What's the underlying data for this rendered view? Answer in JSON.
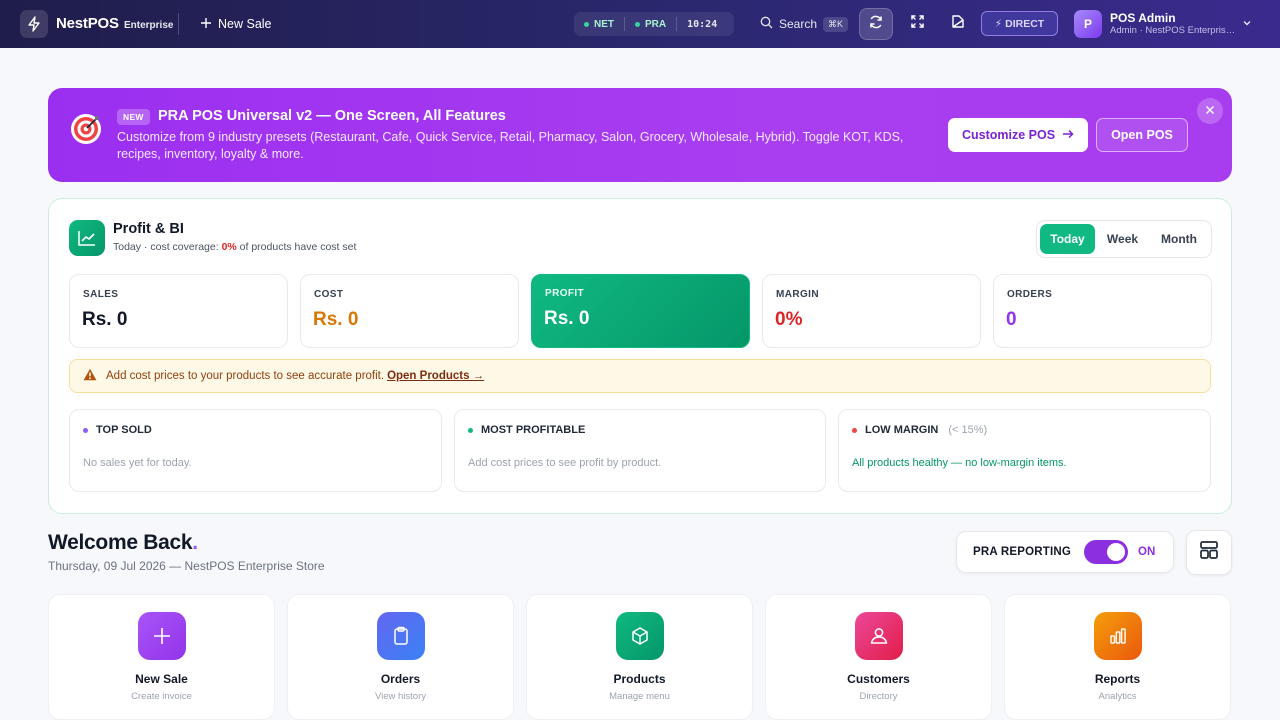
{
  "topbar": {
    "brand": "NestPOS",
    "edition": "Enterprise",
    "new_sale_label": "New Sale",
    "status": {
      "net": "NET",
      "pra": "PRA",
      "time": "10:24"
    },
    "search_label": "Search",
    "search_shortcut": "⌘K",
    "direct_label": "DIRECT",
    "user": {
      "name": "POS Admin",
      "subtitle": "Admin · NestPOS Enterprise...",
      "initial": "P"
    }
  },
  "promo": {
    "badge": "NEW",
    "title": "PRA POS Universal v2 — One Screen, All Features",
    "description": "Customize from 9 industry presets (Restaurant, Cafe, Quick Service, Retail, Pharmacy, Salon, Grocery, Wholesale, Hybrid). Toggle KOT, KDS, recipes, inventory, loyalty & more.",
    "customize_label": "Customize POS",
    "open_label": "Open POS"
  },
  "bi": {
    "title": "Profit & BI",
    "subtitle_prefix": "Today · cost coverage: ",
    "coverage": "0%",
    "subtitle_suffix": " of products have cost set",
    "periods": [
      "Today",
      "Week",
      "Month"
    ],
    "active_period": "Today",
    "metrics": [
      {
        "label": "SALES",
        "value": "Rs. 0",
        "color": "#111827"
      },
      {
        "label": "COST",
        "value": "Rs. 0",
        "color": "#d97706"
      },
      {
        "label": "PROFIT",
        "value": "Rs. 0",
        "color": "#ffffff"
      },
      {
        "label": "MARGIN",
        "value": "0%",
        "color": "#dc2626"
      },
      {
        "label": "ORDERS",
        "value": "0",
        "color": "#9333ea"
      }
    ],
    "warning_text": "Add cost prices to your products to see accurate profit.",
    "warning_link": "Open Products →",
    "insights": [
      {
        "title": "TOP SOLD",
        "note": "",
        "body": "No sales yet for today.",
        "dot": "#8b5cf6"
      },
      {
        "title": "MOST PROFITABLE",
        "note": "",
        "body": "Add cost prices to see profit by product.",
        "dot": "#10b981"
      },
      {
        "title": "LOW MARGIN",
        "note": "(< 15%)",
        "body": "All products healthy — no low-margin items.",
        "dot": "#ef4444"
      }
    ]
  },
  "welcome": {
    "title": "Welcome Back",
    "subtitle": "Thursday, 09 Jul 2026 — NestPOS Enterprise Store",
    "pra_label": "PRA REPORTING",
    "pra_state": "ON"
  },
  "tiles": [
    {
      "title": "New Sale",
      "subtitle": "Create invoice",
      "icon": "plus-icon",
      "color": "#9333ea"
    },
    {
      "title": "Orders",
      "subtitle": "View history",
      "icon": "clipboard-icon",
      "color": "#4f6ef0"
    },
    {
      "title": "Products",
      "subtitle": "Manage menu",
      "icon": "box-icon",
      "color": "#10b981"
    },
    {
      "title": "Customers",
      "subtitle": "Directory",
      "icon": "user-icon",
      "color": "#ec4899"
    },
    {
      "title": "Reports",
      "subtitle": "Analytics",
      "icon": "bar-chart-icon",
      "color": "#f59e0b"
    }
  ]
}
